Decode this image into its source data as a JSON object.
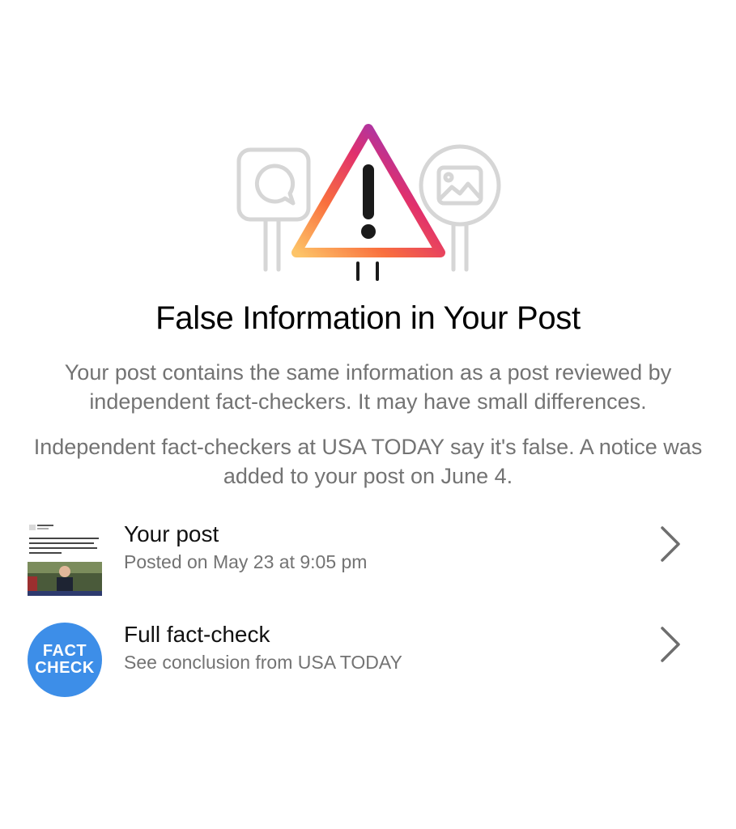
{
  "notice": {
    "title": "False Information in Your Post",
    "paragraph_1": "Your post contains the same information as a post reviewed by independent fact-checkers. It may have small differences.",
    "paragraph_2": "Independent fact-checkers at USA TODAY say it's false.  A notice was added to your post on June 4."
  },
  "items": [
    {
      "title": "Your post",
      "subtitle": "Posted on May 23 at 9:05 pm",
      "icon": "post-thumbnail",
      "chevron": "chevron-right-icon"
    },
    {
      "title": "Full fact-check",
      "subtitle": "See conclusion from USA TODAY",
      "icon": "fact-check-icon",
      "badge_line_1": "FACT",
      "badge_line_2": "CHECK",
      "chevron": "chevron-right-icon"
    }
  ],
  "colors": {
    "warning_gradient": [
      "#fdc468",
      "#f9703e",
      "#e1306c",
      "#9b36b7",
      "#6a3ec9"
    ],
    "badge_blue": "#3d8ee8",
    "secondary_text": "#737373",
    "outline_gray": "#d6d6d6"
  }
}
